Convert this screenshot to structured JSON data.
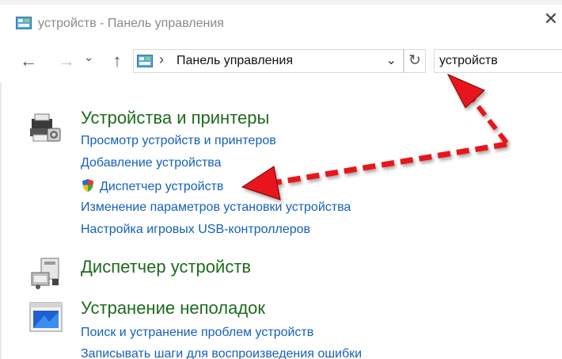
{
  "window": {
    "title": "устройств - Панель управления",
    "close_glyph": "✕"
  },
  "nav": {
    "back_glyph": "←",
    "forward_glyph": "→",
    "recent_glyph": "⌄",
    "up_glyph": "↑",
    "address_separator": "›",
    "address_path": "Панель управления",
    "address_dropdown_glyph": "⌄",
    "refresh_glyph": "↻",
    "search_value": "устройств"
  },
  "groups": [
    {
      "heading": "Устройства и принтеры",
      "links": [
        "Просмотр устройств и принтеров",
        "Добавление устройства",
        "Диспетчер устройств",
        "Изменение параметров установки устройства",
        "Настройка игровых USB-контроллеров"
      ]
    },
    {
      "heading": "Диспетчер устройств",
      "links": []
    },
    {
      "heading": "Устранение неполадок",
      "links": [
        "Поиск и устранение проблем устройств",
        "Записывать шаги для воспроизведения ошибки"
      ]
    }
  ],
  "icons": {
    "app": "control-panel-icon",
    "printer": "printer-icon",
    "device_manager": "device-manager-icon",
    "troubleshoot": "troubleshooting-icon",
    "shield": "shield-icon"
  },
  "colors": {
    "heading": "#1e6b1e",
    "link": "#1560bd",
    "annotation_arrow": "#e8141c"
  }
}
